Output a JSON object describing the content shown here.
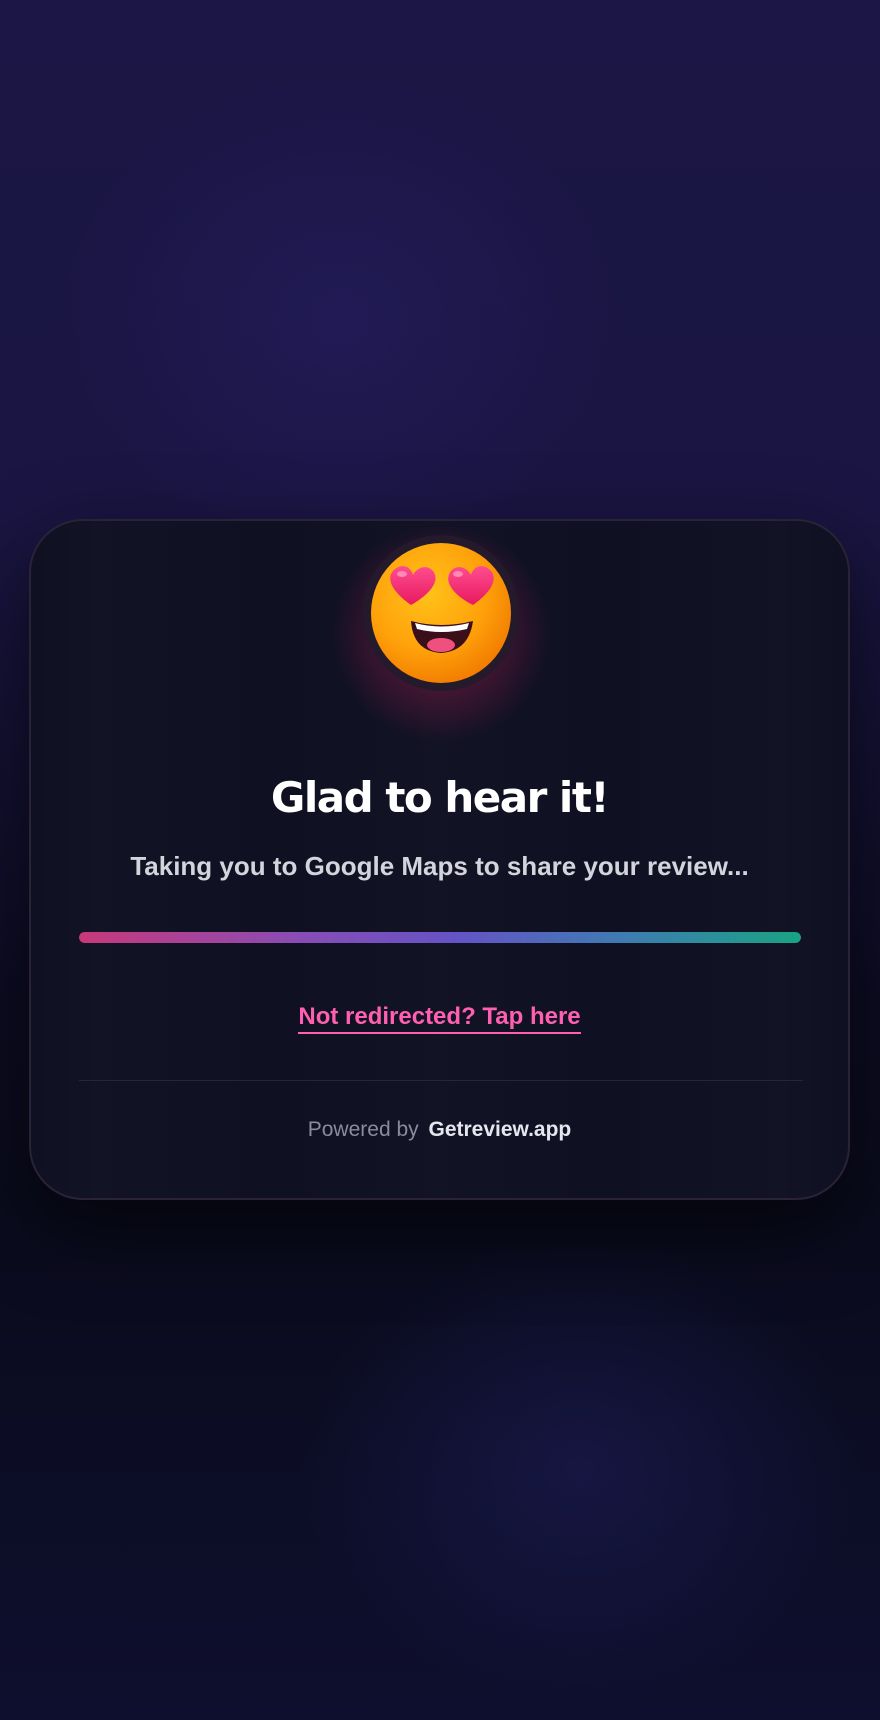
{
  "emoji": {
    "icon": "heart-eyes-emoji-icon"
  },
  "main": {
    "title": "Glad to hear it!",
    "subtitle": "Taking you to Google Maps to share your review...",
    "progress": 1.0,
    "redirect_link": "Not redirected? Tap here"
  },
  "footer": {
    "powered_by": "Powered by",
    "brand": "Getreview.app"
  },
  "colors": {
    "accent_pink": "#ff5fb0",
    "progress_start": "#c8397a",
    "progress_mid": "#6553c6",
    "progress_end": "#19a383",
    "card_bg": "#0f1022"
  }
}
